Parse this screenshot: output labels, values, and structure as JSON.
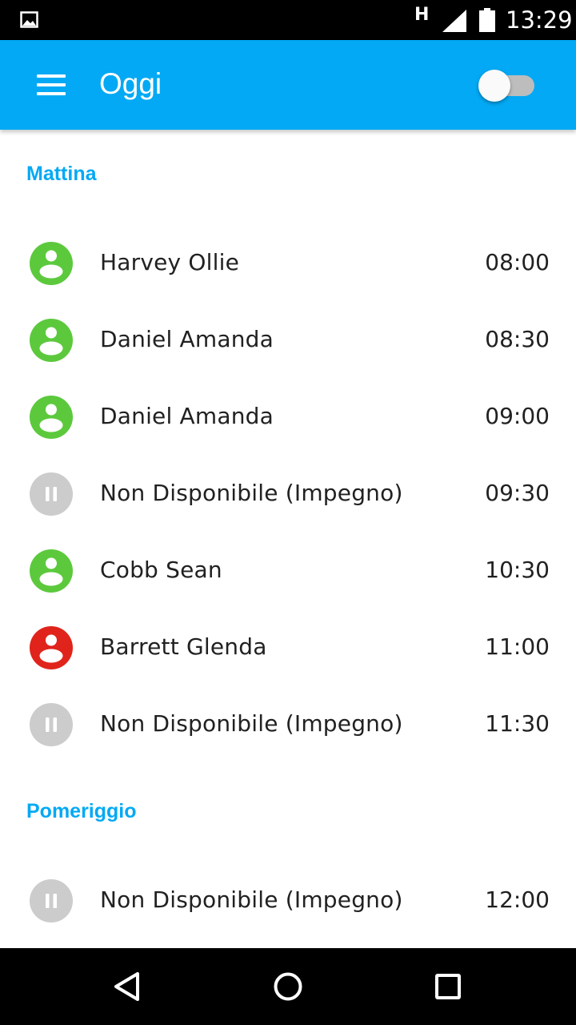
{
  "status_bar": {
    "network": "H",
    "time": "13:29",
    "icons": [
      "image-icon",
      "signal-icon",
      "battery-icon"
    ]
  },
  "app_bar": {
    "title": "Oggi",
    "menu_icon": "menu-icon",
    "toggle_on": false,
    "color": "#03A9F4"
  },
  "sections": [
    {
      "header": "Mattina",
      "items": [
        {
          "name": "Harvey Ollie",
          "time": "08:00",
          "status": "booked",
          "icon": "person-icon",
          "color": "#5CC93D"
        },
        {
          "name": "Daniel Amanda",
          "time": "08:30",
          "status": "booked",
          "icon": "person-icon",
          "color": "#5CC93D"
        },
        {
          "name": "Daniel Amanda",
          "time": "09:00",
          "status": "booked",
          "icon": "person-icon",
          "color": "#5CC93D"
        },
        {
          "name": "Non Disponibile (Impegno)",
          "time": "09:30",
          "status": "unavailable",
          "icon": "pause-icon",
          "color": "#CCCCCC"
        },
        {
          "name": "Cobb Sean",
          "time": "10:30",
          "status": "booked",
          "icon": "person-icon",
          "color": "#5CC93D"
        },
        {
          "name": "Barrett Glenda",
          "time": "11:00",
          "status": "cancelled",
          "icon": "person-icon",
          "color": "#E0241B"
        },
        {
          "name": "Non Disponibile (Impegno)",
          "time": "11:30",
          "status": "unavailable",
          "icon": "pause-icon",
          "color": "#CCCCCC"
        }
      ]
    },
    {
      "header": "Pomeriggio",
      "items": [
        {
          "name": "Non Disponibile (Impegno)",
          "time": "12:00",
          "status": "unavailable",
          "icon": "pause-icon",
          "color": "#CCCCCC"
        }
      ]
    }
  ],
  "nav_bar": {
    "buttons": [
      "back-icon",
      "home-icon",
      "recents-icon"
    ]
  }
}
